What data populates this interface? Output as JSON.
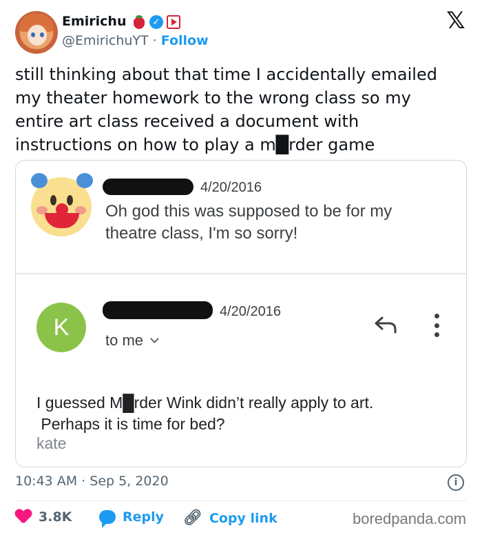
{
  "header": {
    "display_name": "Emirichu",
    "handle": "@EmirichuYT",
    "separator": "·",
    "follow_label": "Follow",
    "x_logo": "𝕏"
  },
  "tweet": {
    "lines": [
      "still thinking about that time I accidentally emailed",
      "my theater homework to the wrong class so my",
      "entire art class received a document with",
      "instructions on how to play a m█rder game"
    ]
  },
  "email": {
    "message1": {
      "date": "4/20/2016",
      "lines": [
        "Oh god this was supposed to be for my",
        "theatre class, I'm so sorry!"
      ]
    },
    "message2": {
      "avatar_letter": "K",
      "date": "4/20/2016",
      "to_label": "to me",
      "lines": [
        "I guessed M█rder Wink didn’t really apply to art.",
        " Perhaps it is time for bed?"
      ],
      "signature": "kate"
    }
  },
  "footer": {
    "timestamp": "10:43 AM · Sep 5, 2020",
    "likes": "3.8K",
    "reply_label": "Reply",
    "copy_label": "Copy link",
    "watermark": "boredpanda.com"
  },
  "colors": {
    "accent": "#1d9bf0",
    "like": "#f91880",
    "k_avatar": "#8bc34a"
  },
  "icons": [
    "strawberry-icon",
    "verified-icon",
    "youtube-icon",
    "x-logo-icon",
    "reply-arrow-icon",
    "more-vert-icon",
    "info-icon",
    "heart-icon",
    "reply-bubble-icon",
    "link-icon"
  ]
}
